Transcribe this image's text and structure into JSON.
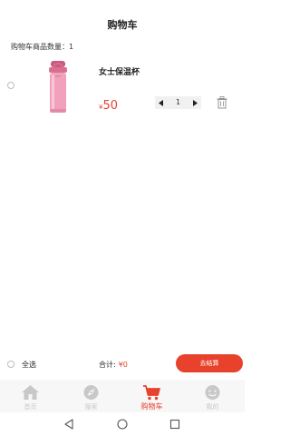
{
  "header": {
    "title": "购物车"
  },
  "summary": {
    "count_label": "购物车商品数量：1"
  },
  "cart": {
    "items": [
      {
        "name": "女士保温杯",
        "currency": "¥",
        "price": "50",
        "quantity": "1"
      }
    ]
  },
  "footer": {
    "select_all": "全选",
    "total_label": "合计:",
    "total_amount": "¥0",
    "checkout": "去结算"
  },
  "tabs": [
    {
      "label": "首页",
      "icon": "home-icon"
    },
    {
      "label": "搜索",
      "icon": "compass-icon"
    },
    {
      "label": "购物车",
      "icon": "cart-icon",
      "active": true
    },
    {
      "label": "我的",
      "icon": "face-icon"
    }
  ],
  "system_nav": [
    "back-icon",
    "home-circle-icon",
    "recents-icon"
  ],
  "colors": {
    "accent": "#e8412c",
    "inactive_tab": "#c8c8c8",
    "tab_background": "#f7f7f7",
    "product_pink": "#f2a1bc"
  }
}
